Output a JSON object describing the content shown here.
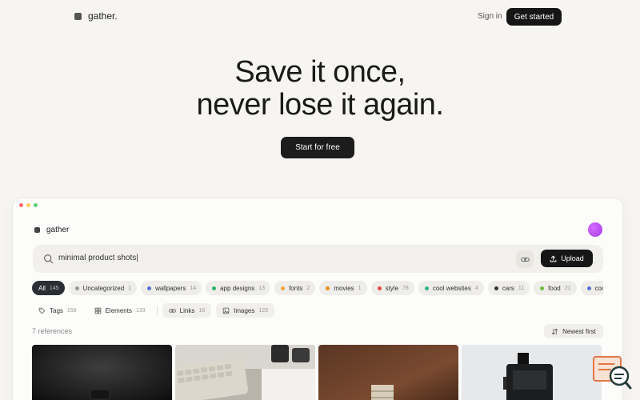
{
  "nav": {
    "brand": "gather.",
    "signin": "Sign in",
    "get_started": "Get started"
  },
  "hero": {
    "line1": "Save it once,",
    "line2": "never lose it again.",
    "cta": "Start for free"
  },
  "app": {
    "brand": "gather",
    "search": {
      "value": "minimal product shots|",
      "upload_label": "Upload"
    },
    "chips": [
      {
        "label": "All",
        "count": "145",
        "color": "",
        "active": true
      },
      {
        "label": "Uncategorized",
        "count": "1",
        "color": "#9a9a9a"
      },
      {
        "label": "wallpapers",
        "count": "14",
        "color": "#5b6fd6"
      },
      {
        "label": "app designs",
        "count": "13",
        "color": "#2fb36a"
      },
      {
        "label": "fonts",
        "count": "2",
        "color": "#f0a23a"
      },
      {
        "label": "movies",
        "count": "1",
        "color": "#f08a24"
      },
      {
        "label": "style",
        "count": "78",
        "color": "#e2463c"
      },
      {
        "label": "cool websites",
        "count": "4",
        "color": "#2eb67d"
      },
      {
        "label": "cars",
        "count": "11",
        "color": "#333333"
      },
      {
        "label": "food",
        "count": "21",
        "color": "#6fbd3d"
      },
      {
        "label": "coo",
        "count": "",
        "color": "#5b6fd6"
      }
    ],
    "filters": [
      {
        "label": "Tags",
        "count": "158",
        "icon": "tag-icon"
      },
      {
        "label": "Elements",
        "count": "133",
        "icon": "grid-icon"
      },
      {
        "label": "Links",
        "count": "16",
        "icon": "link-icon"
      },
      {
        "label": "Images",
        "count": "129",
        "icon": "image-icon"
      }
    ],
    "refs_count": "7 references",
    "sort_label": "Newest first"
  }
}
